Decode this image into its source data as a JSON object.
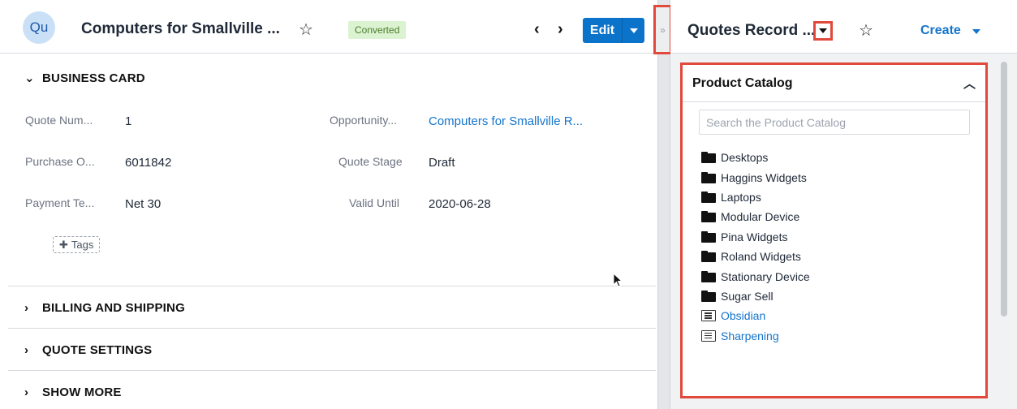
{
  "record": {
    "avatar_initials": "Qu",
    "title": "Computers for Smallville ...",
    "status": "Converted",
    "prev_label": "‹",
    "next_label": "›",
    "edit_label": "Edit"
  },
  "business_card": {
    "heading": "BUSINESS CARD",
    "fields": [
      {
        "label": "Quote Num...",
        "value": "1"
      },
      {
        "label": "Purchase O...",
        "value": "6011842"
      },
      {
        "label": "Payment Te...",
        "value": "Net 30"
      },
      {
        "label": "Opportunity...",
        "value": "Computers for Smallville R..."
      },
      {
        "label": "Quote Stage",
        "value": "Draft"
      },
      {
        "label": "Valid Until",
        "value": "2020-06-28"
      }
    ],
    "tags_label": "Tags"
  },
  "collapsed_sections": [
    {
      "heading": "BILLING AND SHIPPING"
    },
    {
      "heading": "QUOTE SETTINGS"
    },
    {
      "heading": "SHOW MORE"
    }
  ],
  "splitter": {
    "toggle_glyph": "»"
  },
  "dashboard": {
    "title": "Quotes Record ...",
    "create_label": "Create"
  },
  "product_catalog": {
    "title": "Product Catalog",
    "search_placeholder": "Search the Product Catalog",
    "items": [
      {
        "label": "Desktops",
        "type": "folder"
      },
      {
        "label": "Haggins Widgets",
        "type": "folder"
      },
      {
        "label": "Laptops",
        "type": "folder"
      },
      {
        "label": "Modular Device",
        "type": "folder"
      },
      {
        "label": "Pina Widgets",
        "type": "folder"
      },
      {
        "label": "Roland Widgets",
        "type": "folder"
      },
      {
        "label": "Stationary Device",
        "type": "folder"
      },
      {
        "label": "Sugar Sell",
        "type": "folder"
      },
      {
        "label": "Obsidian",
        "type": "product"
      },
      {
        "label": "Sharpening",
        "type": "product"
      }
    ]
  },
  "colors": {
    "accent": "#0b73c9",
    "link": "#1474cc",
    "highlight_border": "#e0493b",
    "status_bg": "#dbf3d0"
  }
}
